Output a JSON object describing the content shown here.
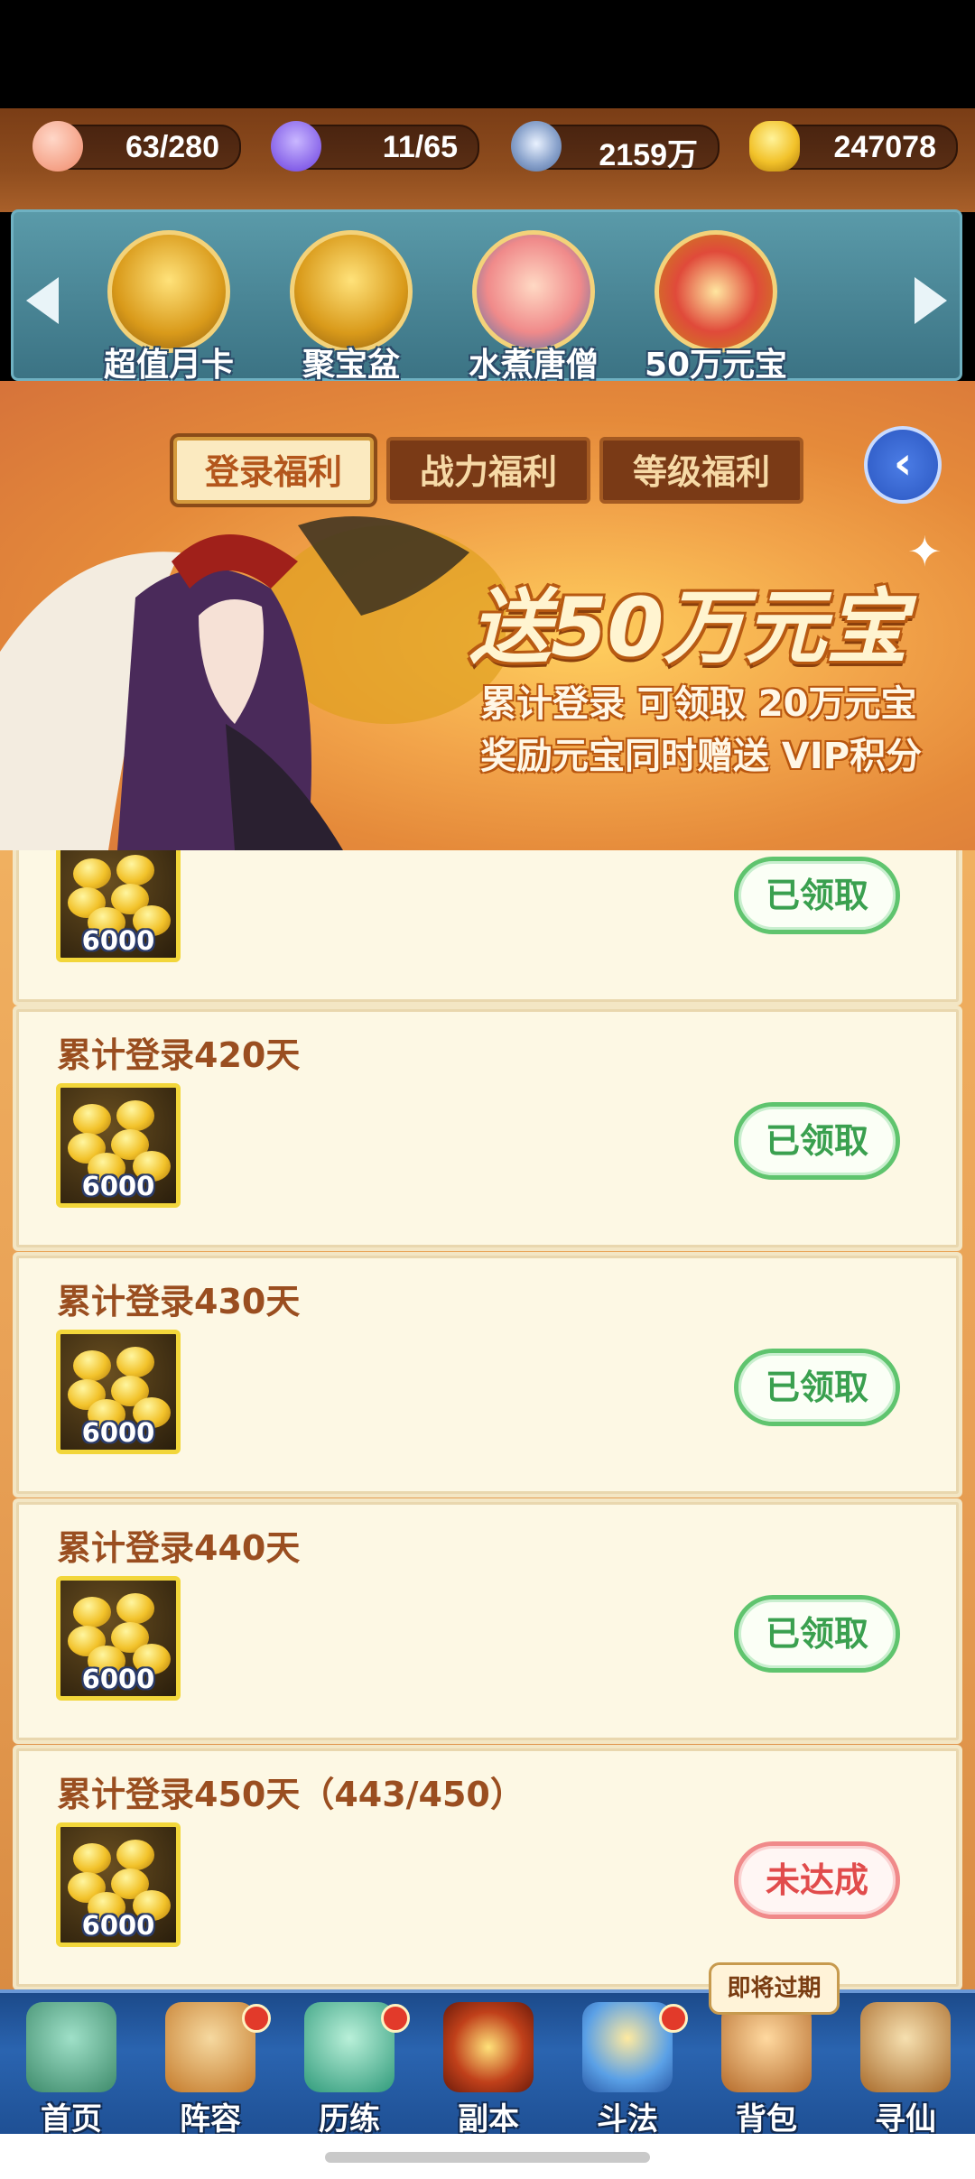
{
  "resources": [
    {
      "name": "stamina-peach",
      "value": "63/280",
      "color": "#f4a38a"
    },
    {
      "name": "spirit-flame",
      "value": "11/65",
      "color": "#7a5cff"
    },
    {
      "name": "copper-coin",
      "value": "2159万",
      "color": "#9fb3d9"
    },
    {
      "name": "gold-ingot",
      "value": "247078",
      "color": "#f2c42a"
    }
  ],
  "shortcuts": [
    {
      "label": "超值月卡",
      "icon": "month-card-icon"
    },
    {
      "label": "聚宝盆",
      "icon": "treasure-bowl-icon"
    },
    {
      "label": "水煮唐僧",
      "icon": "monk-icon"
    },
    {
      "label": "50万元宝",
      "icon": "gold-chest-icon"
    }
  ],
  "tabs": [
    {
      "label": "登录福利",
      "active": true
    },
    {
      "label": "战力福利",
      "active": false
    },
    {
      "label": "等级福利",
      "active": false
    }
  ],
  "banner": {
    "title": "送50万元宝",
    "line1": "累计登录 可领取 20万元宝",
    "line2": "奖励元宝同时赠送 VIP积分"
  },
  "rewards": [
    {
      "title": "",
      "qty": "6000",
      "status": "已领取",
      "done": true
    },
    {
      "title": "累计登录420天",
      "qty": "6000",
      "status": "已领取",
      "done": true
    },
    {
      "title": "累计登录430天",
      "qty": "6000",
      "status": "已领取",
      "done": true
    },
    {
      "title": "累计登录440天",
      "qty": "6000",
      "status": "已领取",
      "done": true
    },
    {
      "title": "累计登录450天（443/450）",
      "qty": "6000",
      "status": "未达成",
      "done": false
    }
  ],
  "expire_tip": "即将过期",
  "nav": [
    {
      "label": "首页",
      "icon": "home-icon",
      "dot": false
    },
    {
      "label": "阵容",
      "icon": "lineup-icon",
      "dot": true
    },
    {
      "label": "历练",
      "icon": "training-icon",
      "dot": true
    },
    {
      "label": "副本",
      "icon": "dungeon-icon",
      "dot": false
    },
    {
      "label": "斗法",
      "icon": "battle-icon",
      "dot": true
    },
    {
      "label": "背包",
      "icon": "bag-icon",
      "dot": false
    },
    {
      "label": "寻仙",
      "icon": "scroll-icon",
      "dot": false
    }
  ]
}
